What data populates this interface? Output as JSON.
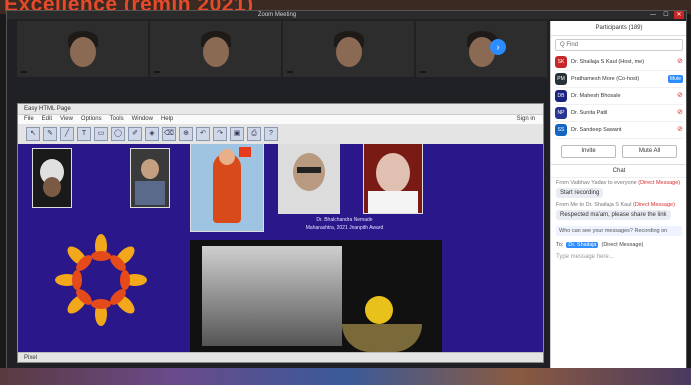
{
  "top_banner": {
    "text": "Excellence (remin 2021)"
  },
  "window": {
    "title": "Zoom Meeting",
    "controls": [
      "—",
      "☐",
      "✕"
    ]
  },
  "video_tiles": [
    {
      "name": ""
    },
    {
      "name": ""
    },
    {
      "name": ""
    },
    {
      "name": ""
    }
  ],
  "next_icon": "chevron-right-icon",
  "share_app": {
    "title": "Easy HTML Page",
    "menu": [
      "File",
      "Edit",
      "View",
      "Options",
      "Tools",
      "Window",
      "Help"
    ],
    "sign_in": "Sign in",
    "toolbar_icons": [
      "arrow",
      "pen",
      "line",
      "text",
      "rect",
      "oval",
      "brush",
      "fill",
      "erase",
      "zoom",
      "undo",
      "redo",
      "save",
      "print",
      "help"
    ],
    "status": "Pixel",
    "caption_line1": "Dr. Bhalchandra Nemade",
    "caption_line2": "Maharashtra, 2021 Jnanpith Award"
  },
  "participants": {
    "header": "Participants (189)",
    "search": "Q Find",
    "list": [
      {
        "initials": "SK",
        "name": "Dr. Shailaja S Kaul (Host, me)",
        "color": "#c62828"
      },
      {
        "initials": "PM",
        "name": "Prathamesh More (Co-host)",
        "color": "#263238",
        "badge": "Mute"
      },
      {
        "initials": "DB",
        "name": "Dr. Mahesh Bhosale",
        "color": "#1a237e"
      },
      {
        "initials": "NP",
        "name": "Dr. Sunita Patil",
        "color": "#283593"
      },
      {
        "initials": "SS",
        "name": "Dr. Sandeep Sawant",
        "color": "#1565c0"
      }
    ],
    "invite": "Invite",
    "mute_all": "Mute All"
  },
  "chat": {
    "header": "Chat",
    "messages": [
      {
        "meta": "From Vaibhav Yadav to everyone",
        "dm": "(Direct Message)",
        "text": "Start recording"
      },
      {
        "meta": "From Me to Dr. Shailaja S Kaul",
        "dm": "(Direct Message)",
        "text": "Respected ma'am, please share the link"
      }
    ],
    "notice": "Who can see your messages? Recording on",
    "to_label": "To:",
    "to_value": "Dr. Shailaja",
    "to_dm": "(Direct Message)",
    "placeholder": "Type message here..."
  }
}
